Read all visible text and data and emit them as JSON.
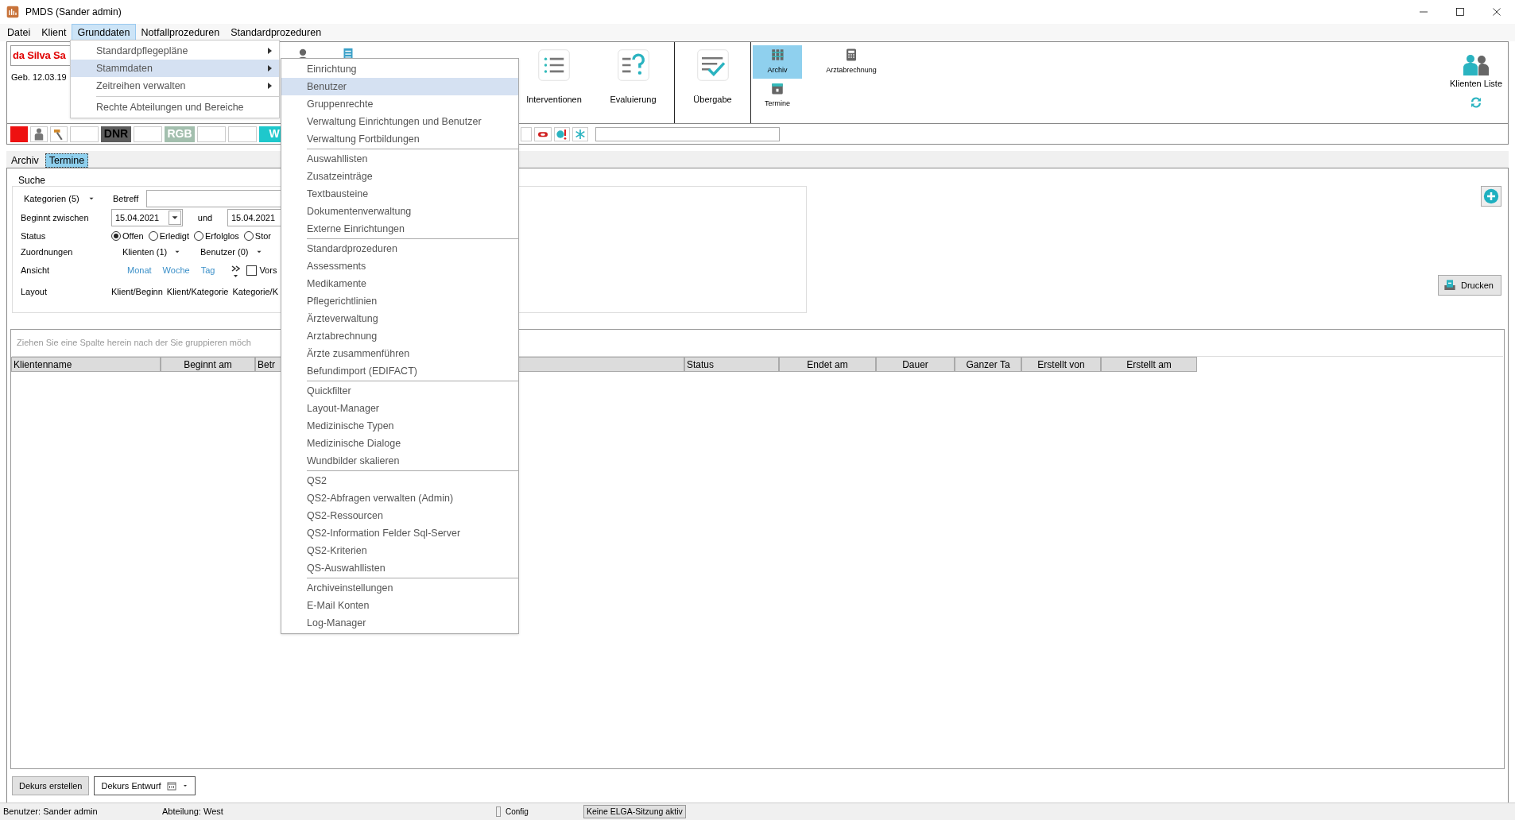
{
  "window": {
    "title": "PMDS (Sander admin)"
  },
  "menu_bar": [
    {
      "label": "Datei",
      "selected": false
    },
    {
      "label": "Klient",
      "selected": false
    },
    {
      "label": "Grunddaten",
      "selected": true
    },
    {
      "label": "Notfallprozeduren",
      "selected": false
    },
    {
      "label": "Standardprozeduren",
      "selected": false
    }
  ],
  "grunddaten_menu": {
    "groups": [
      [
        {
          "label": "Standardpflegepläne",
          "submenu": true,
          "selected": false
        },
        {
          "label": "Stammdaten",
          "submenu": true,
          "selected": true
        },
        {
          "label": "Zeitreihen verwalten",
          "submenu": true,
          "selected": false
        }
      ],
      [
        {
          "label": "Rechte Abteilungen und Bereiche",
          "submenu": false,
          "selected": false
        }
      ]
    ]
  },
  "stammdaten_menu": {
    "groups": [
      [
        {
          "label": "Einrichtung",
          "selected": false
        },
        {
          "label": "Benutzer",
          "selected": true
        },
        {
          "label": "Gruppenrechte",
          "selected": false
        },
        {
          "label": "Verwaltung Einrichtungen und Benutzer",
          "selected": false
        },
        {
          "label": "Verwaltung Fortbildungen",
          "selected": false
        }
      ],
      [
        {
          "label": "Auswahllisten",
          "selected": false
        },
        {
          "label": "Zusatzeinträge",
          "selected": false
        },
        {
          "label": "Textbausteine",
          "selected": false
        },
        {
          "label": "Dokumentenverwaltung",
          "selected": false
        },
        {
          "label": "Externe Einrichtungen",
          "selected": false
        }
      ],
      [
        {
          "label": "Standardprozeduren",
          "selected": false
        },
        {
          "label": "Assessments",
          "selected": false
        },
        {
          "label": "Medikamente",
          "selected": false
        },
        {
          "label": "Pflegerichtlinien",
          "selected": false
        },
        {
          "label": "Ärzteverwaltung",
          "selected": false
        },
        {
          "label": "Arztabrechnung",
          "selected": false
        },
        {
          "label": "Ärzte zusammenführen",
          "selected": false
        },
        {
          "label": "Befundimport (EDIFACT)",
          "selected": false
        }
      ],
      [
        {
          "label": "Quickfilter",
          "selected": false
        },
        {
          "label": "Layout-Manager",
          "selected": false
        },
        {
          "label": "Medizinische Typen",
          "selected": false
        },
        {
          "label": "Medizinische  Dialoge",
          "selected": false
        },
        {
          "label": "Wundbilder skalieren",
          "selected": false
        }
      ],
      [
        {
          "label": "QS2",
          "selected": false
        },
        {
          "label": "QS2-Abfragen verwalten (Admin)",
          "selected": false
        },
        {
          "label": "QS2-Ressourcen",
          "selected": false
        },
        {
          "label": "QS2-Information Felder Sql-Server",
          "selected": false
        },
        {
          "label": "QS2-Kriterien",
          "selected": false
        },
        {
          "label": "QS-Auswahllisten",
          "selected": false
        }
      ],
      [
        {
          "label": "Archiveinstellungen",
          "selected": false
        },
        {
          "label": "E-Mail Konten",
          "selected": false
        },
        {
          "label": "Log-Manager",
          "selected": false
        }
      ]
    ]
  },
  "patient": {
    "name": "da Silva Sa",
    "birth": "Geb. 12.03.19"
  },
  "toolbar": [
    {
      "kind": "list",
      "label": "Interventionen"
    },
    {
      "kind": "question",
      "label": "Evaluierung"
    },
    {
      "kind": "check",
      "label": "Übergabe"
    }
  ],
  "toolbar_small": [
    {
      "kind": "binders",
      "label": "Archiv",
      "selected": true
    },
    {
      "kind": "calculator",
      "label": "Arztabrechnung",
      "selected": false
    },
    {
      "kind": "calendar",
      "label": "Termine",
      "selected": false
    }
  ],
  "klienten_liste": "Klienten Liste",
  "flags": [
    {
      "kind": "swatch",
      "color": "#ee1111"
    },
    {
      "kind": "person"
    },
    {
      "kind": "tool"
    },
    {
      "kind": "blank"
    },
    {
      "kind": "tag",
      "label": "DNR",
      "color": "#5c5c5c"
    },
    {
      "kind": "blank"
    },
    {
      "kind": "tag",
      "label": "RGB",
      "color": "#a3bfae"
    },
    {
      "kind": "blank"
    },
    {
      "kind": "blank"
    },
    {
      "kind": "tag",
      "label": "W",
      "color": "#1ec8cc"
    }
  ],
  "flags_right": [
    {
      "kind": "blank"
    },
    {
      "kind": "pill"
    },
    {
      "kind": "alert"
    },
    {
      "kind": "asterisk"
    },
    {
      "kind": "field"
    }
  ],
  "tabs": [
    {
      "label": "Archiv",
      "selected": false
    },
    {
      "label": "Termine",
      "selected": true
    }
  ],
  "search": {
    "title": "Suche",
    "kategorien": "Kategorien (5)",
    "betreff_label": "Betreff",
    "beginnt_label": "Beginnt zwischen",
    "date_from": "15.04.2021",
    "und": "und",
    "date_to": "15.04.2021",
    "status_label": "Status",
    "status_options": [
      {
        "label": "Offen",
        "selected": true
      },
      {
        "label": "Erledigt",
        "selected": false
      },
      {
        "label": "Erfolglos",
        "selected": false
      },
      {
        "label": "Stor",
        "selected": false
      }
    ],
    "zuordnungen_label": "Zuordnungen",
    "zuordnungen": [
      "Klienten (1)",
      "Benutzer (0)"
    ],
    "ansicht_label": "Ansicht",
    "ansicht": [
      "Monat",
      "Woche",
      "Tag"
    ],
    "vors": {
      "label": "Vors",
      "checked": false
    },
    "layout_label": "Layout",
    "layouts": [
      "Klient/Beginn",
      "Klient/Kategorie",
      "Kategorie/K"
    ]
  },
  "print_button": "Drucken",
  "group_hint": "Ziehen Sie eine Spalte herein nach der Sie gruppieren möch",
  "columns": [
    "Klientenname",
    "Beginnt am",
    "Betr",
    "Status",
    "Endet am",
    "Dauer",
    "Ganzer Ta",
    "Erstellt von",
    "Erstellt am"
  ],
  "bottom_buttons": [
    "Dekurs erstellen",
    "Dekurs Entwurf"
  ],
  "status_bar": [
    "Benutzer: Sander admin",
    "Abteilung: West",
    "Config",
    "Keine ELGA-Sitzung aktiv"
  ]
}
